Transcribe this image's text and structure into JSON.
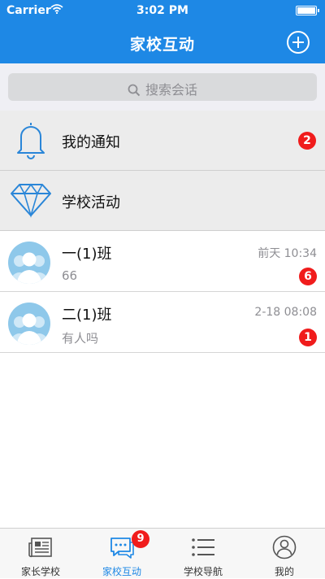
{
  "status_bar": {
    "carrier": "Carrier",
    "time": "3:02 PM"
  },
  "nav": {
    "title": "家校互动",
    "add_icon": "plus-circle-icon"
  },
  "search": {
    "placeholder": "搜索会话",
    "icon": "search-icon"
  },
  "fixed_items": [
    {
      "label": "我的通知",
      "icon": "bell-icon",
      "badge": "2"
    },
    {
      "label": "学校活动",
      "icon": "diamond-icon"
    }
  ],
  "chats": [
    {
      "name": "一(1)班",
      "time": "前天 10:34",
      "preview": "66",
      "badge": "6",
      "avatar": "group-avatar-icon"
    },
    {
      "name": "二(1)班",
      "time": "2-18 08:08",
      "preview": "有人吗",
      "badge": "1",
      "avatar": "group-avatar-icon"
    }
  ],
  "tabbar": {
    "tabs": [
      {
        "label": "家长学校",
        "icon": "newspaper-icon",
        "active": false
      },
      {
        "label": "家校互动",
        "icon": "chat-bubble-icon",
        "active": true,
        "badge": "9"
      },
      {
        "label": "学校导航",
        "icon": "list-icon",
        "active": false
      },
      {
        "label": "我的",
        "icon": "profile-icon",
        "active": false
      }
    ]
  },
  "colors": {
    "accent": "#1e88e5",
    "badge": "#f01c1c",
    "avatar_bg": "#8ec8ea"
  }
}
